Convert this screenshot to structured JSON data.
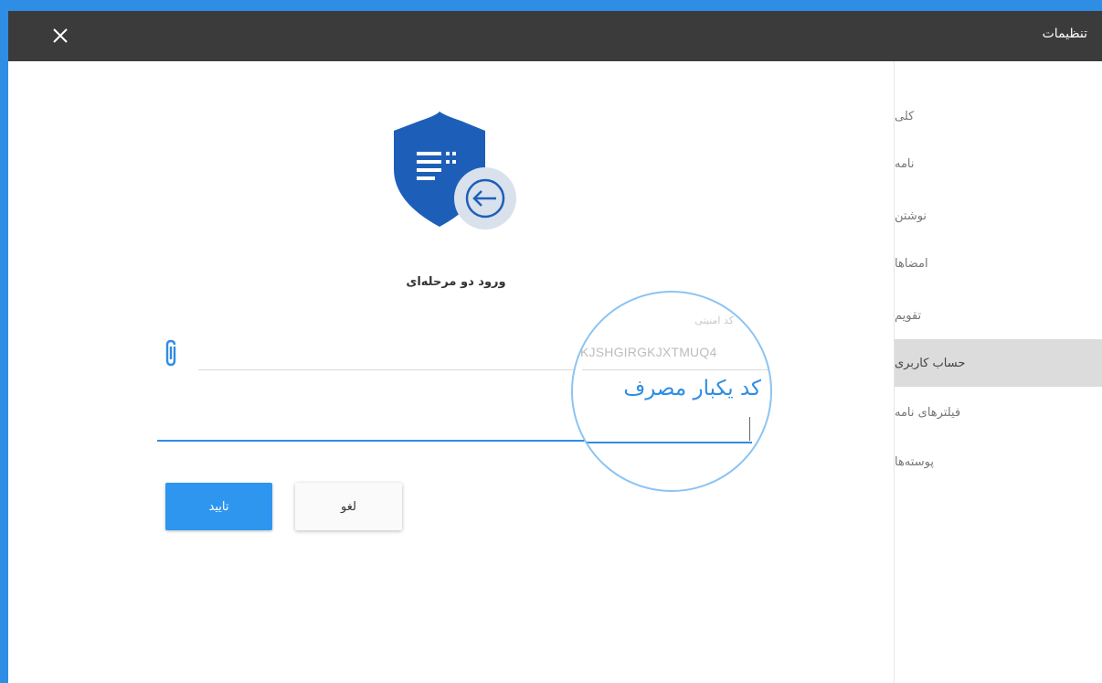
{
  "window": {
    "title": "تنظیمات"
  },
  "sidebar": {
    "items": [
      {
        "label": "کلی"
      },
      {
        "label": "نامه"
      },
      {
        "label": "نوشتن"
      },
      {
        "label": "امضاها"
      },
      {
        "label": "تقویم"
      },
      {
        "label": "حساب کاربری",
        "active": true
      },
      {
        "label": "فیلترهای نامه"
      },
      {
        "label": "پوسته‌ها"
      }
    ]
  },
  "main": {
    "title": "ورود دو مرحله‌ای",
    "secret_field": {
      "label": "کد امنیتی",
      "value": "KJSHGIRGKJXTMUQ4"
    },
    "otp_field": {
      "label": "کد یکبار مصرف",
      "value": ""
    },
    "buttons": {
      "confirm": "تایید",
      "cancel": "لغو"
    }
  },
  "icons": {
    "close": "close-icon",
    "attach": "paperclip-icon",
    "shield": "shield-login-icon"
  },
  "colors": {
    "accent": "#2e8de4",
    "titlebar": "#3b3b3b",
    "shield_blue": "#1d5fb8",
    "active_item": "#dcdcdc"
  }
}
